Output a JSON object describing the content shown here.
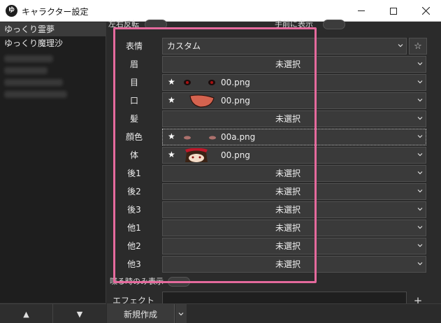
{
  "window": {
    "icon_text": "ゆ",
    "title": "キャラクター設定"
  },
  "characters": [
    "ゆっくり霊夢",
    "ゆっくり魔理沙"
  ],
  "toggles": {
    "flip_label": "左右反転",
    "front_label": "手前に表示",
    "speaking_only_label": "喋る時のみ表示"
  },
  "rows": [
    {
      "label": "表情",
      "value": "カスタム",
      "has_star": false,
      "image": ""
    },
    {
      "label": "眉",
      "value": "未選択",
      "has_star": false,
      "image": ""
    },
    {
      "label": "目",
      "value": "00.png",
      "has_star": true,
      "image": "eyes"
    },
    {
      "label": "口",
      "value": "00.png",
      "has_star": true,
      "image": "mouth"
    },
    {
      "label": "髪",
      "value": "未選択",
      "has_star": false,
      "image": ""
    },
    {
      "label": "顔色",
      "value": "00a.png",
      "has_star": true,
      "image": "blush"
    },
    {
      "label": "体",
      "value": "00.png",
      "has_star": true,
      "image": "body"
    },
    {
      "label": "後1",
      "value": "未選択",
      "has_star": false,
      "image": ""
    },
    {
      "label": "後2",
      "value": "未選択",
      "has_star": false,
      "image": ""
    },
    {
      "label": "後3",
      "value": "未選択",
      "has_star": false,
      "image": ""
    },
    {
      "label": "他1",
      "value": "未選択",
      "has_star": false,
      "image": ""
    },
    {
      "label": "他2",
      "value": "未選択",
      "has_star": false,
      "image": ""
    },
    {
      "label": "他3",
      "value": "未選択",
      "has_star": false,
      "image": ""
    }
  ],
  "star_glyph": "★",
  "favorite_glyph": "☆",
  "effect_label": "エフェクト",
  "add_glyph": "+",
  "new_button": "新規作成",
  "up_glyph": "▲",
  "down_glyph": "▼",
  "colors": {
    "highlight": "#e56a9d",
    "panel": "#2b2b2b"
  }
}
